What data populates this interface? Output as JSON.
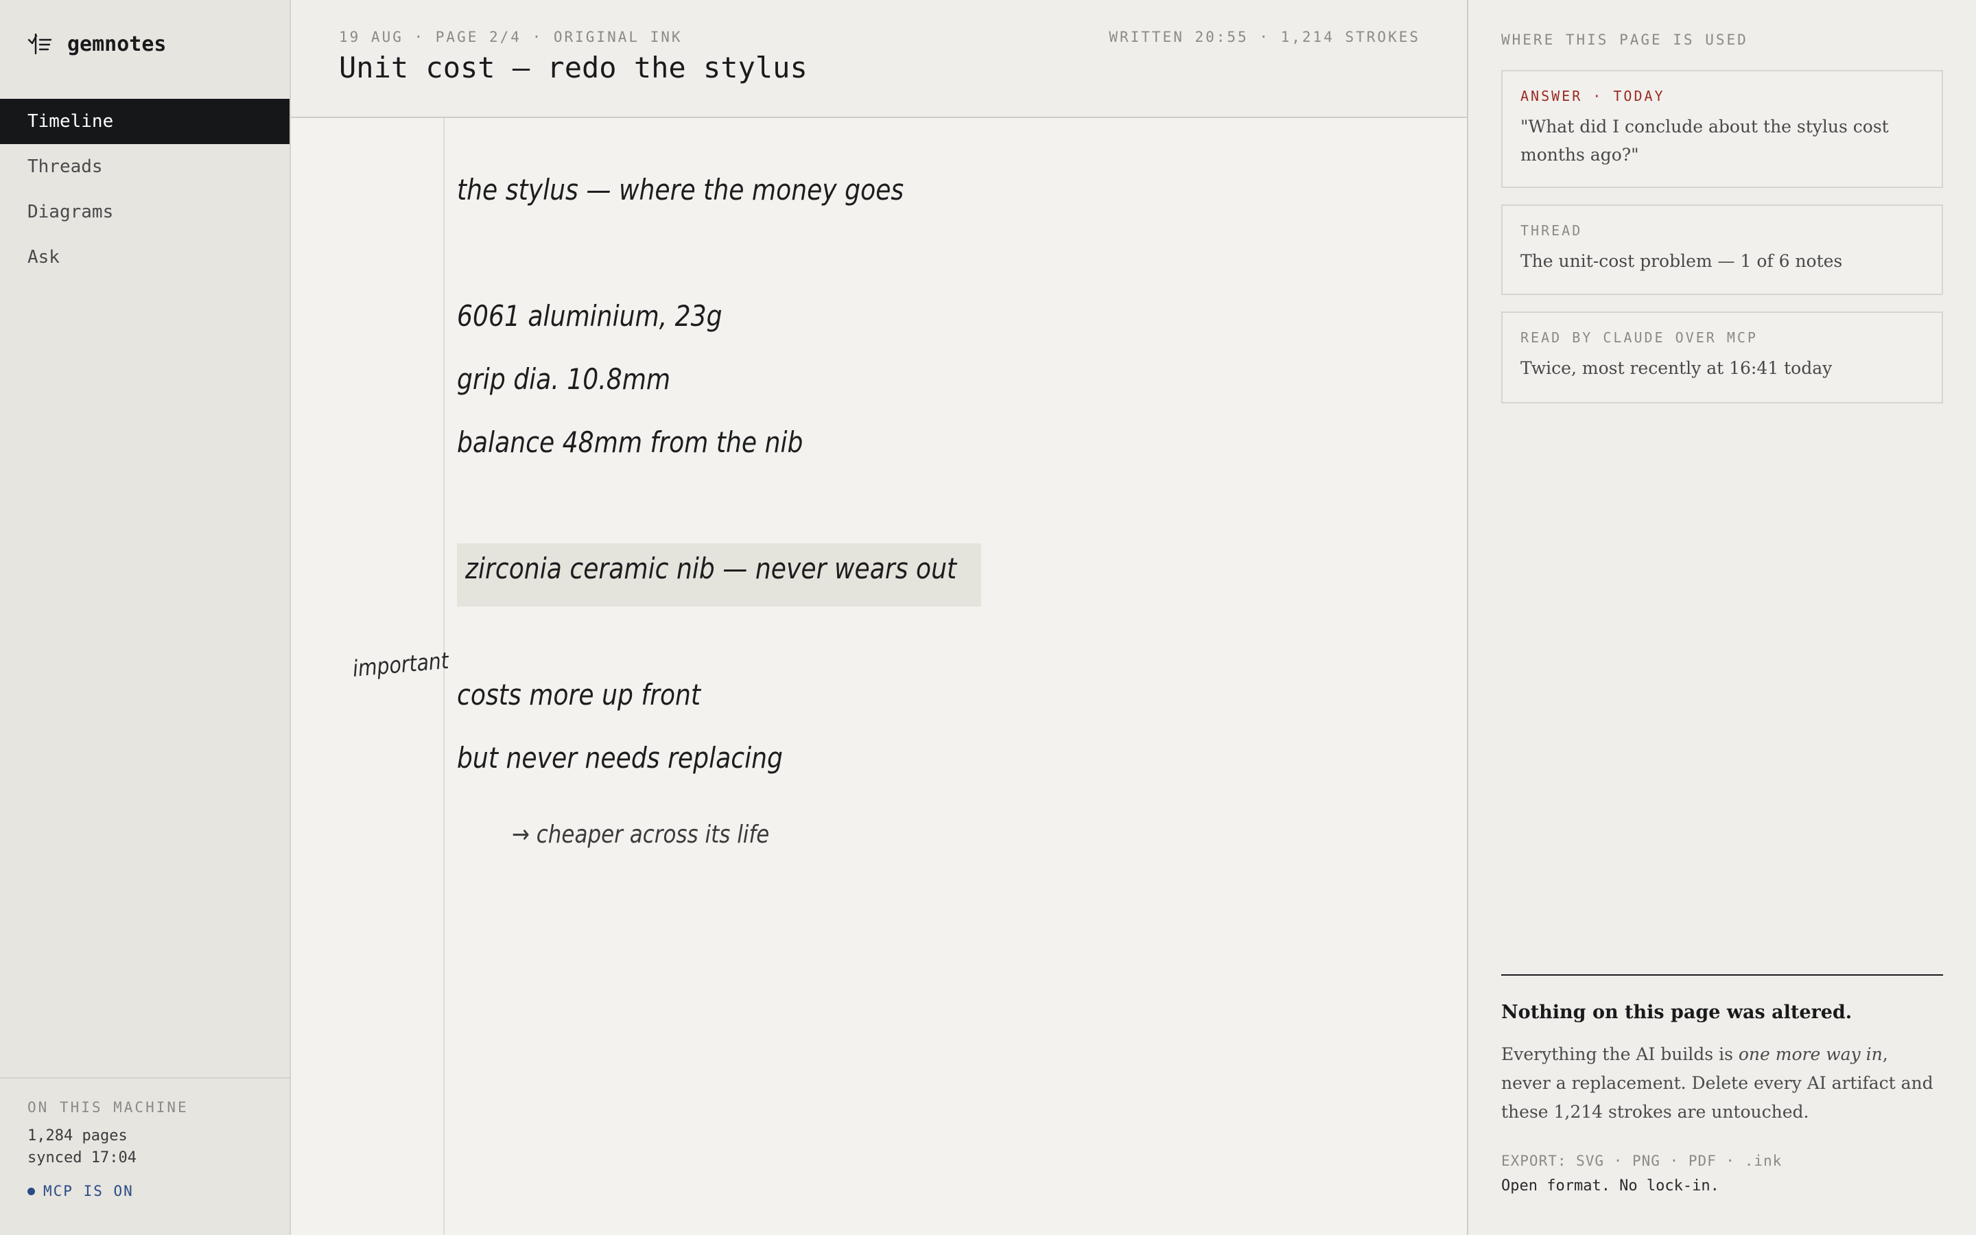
{
  "app": {
    "name": "gemnotes"
  },
  "sidebar": {
    "items": [
      {
        "label": "Timeline",
        "active": true
      },
      {
        "label": "Threads",
        "active": false
      },
      {
        "label": "Diagrams",
        "active": false
      },
      {
        "label": "Ask",
        "active": false
      }
    ],
    "machine": {
      "heading": "ON THIS MACHINE",
      "pages": "1,284 pages",
      "synced": "synced 17:04",
      "mcp_status": "MCP IS ON"
    }
  },
  "page": {
    "meta_left": "19 AUG · PAGE 2/4 · ORIGINAL INK",
    "meta_right": "WRITTEN 20:55 · 1,214 STROKES",
    "title": "Unit cost — redo the stylus",
    "ink_lines": [
      "the stylus — where the money goes",
      "6061 aluminium, 23g",
      "grip dia. 10.8mm",
      "balance 48mm from the nib",
      "zirconia ceramic nib — never wears out",
      "costs more up front",
      "but never needs replacing",
      "→ cheaper across its life"
    ],
    "margin_note": "important"
  },
  "panel": {
    "heading": "WHERE THIS PAGE IS USED",
    "cards": [
      {
        "label": "ANSWER · TODAY",
        "text": "\"What did I conclude about the stylus cost months ago?\""
      },
      {
        "label": "THREAD",
        "text": "The unit-cost problem — 1 of 6 notes"
      },
      {
        "label": "READ BY CLAUDE OVER MCP",
        "text": "Twice, most recently at 16:41 today"
      }
    ],
    "unaltered": {
      "title": "Nothing on this page was altered.",
      "body_before": "Everything the AI builds is ",
      "body_emphasis": "one more way in",
      "body_after": ", never a replacement. Delete every AI artifact and these 1,214 strokes are untouched."
    },
    "export": "EXPORT: SVG · PNG · PDF · .ink",
    "open_format": "Open format. No lock-in."
  },
  "colors": {
    "sidebar_bg": "#e7e5e0",
    "active_nav_bg": "#161719",
    "accent_red": "#9b2a24",
    "mcp_blue": "#2a4c86",
    "highlight": "#e4e3dc"
  },
  "icons": {
    "brand": "checklist-icon"
  }
}
